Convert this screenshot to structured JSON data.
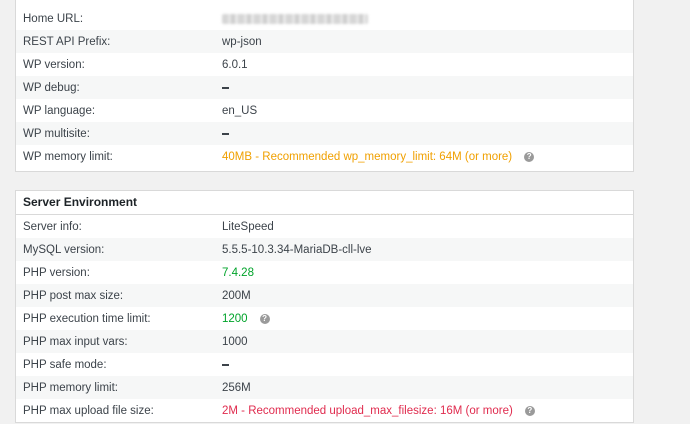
{
  "wordpress_environment": {
    "rows": [
      {
        "label": "Home URL:",
        "value": "",
        "type": "redacted"
      },
      {
        "label": "REST API Prefix:",
        "value": "wp-json",
        "type": "normal"
      },
      {
        "label": "WP version:",
        "value": "6.0.1",
        "type": "normal"
      },
      {
        "label": "WP debug:",
        "value": "",
        "type": "dash"
      },
      {
        "label": "WP language:",
        "value": "en_US",
        "type": "normal"
      },
      {
        "label": "WP multisite:",
        "value": "",
        "type": "dash"
      },
      {
        "label": "WP memory limit:",
        "value": "40MB - Recommended wp_memory_limit: 64M (or more)",
        "type": "warn",
        "help": true
      }
    ]
  },
  "server_environment": {
    "title": "Server Environment",
    "rows": [
      {
        "label": "Server info:",
        "value": "LiteSpeed",
        "type": "normal"
      },
      {
        "label": "MySQL version:",
        "value": "5.5.5-10.3.34-MariaDB-cll-lve",
        "type": "normal"
      },
      {
        "label": "PHP version:",
        "value": "7.4.28",
        "type": "ok"
      },
      {
        "label": "PHP post max size:",
        "value": "200M",
        "type": "normal"
      },
      {
        "label": "PHP execution time limit:",
        "value": "1200",
        "type": "ok",
        "help": true
      },
      {
        "label": "PHP max input vars:",
        "value": "1000",
        "type": "normal"
      },
      {
        "label": "PHP safe mode:",
        "value": "",
        "type": "dash"
      },
      {
        "label": "PHP memory limit:",
        "value": "256M",
        "type": "normal"
      },
      {
        "label": "PHP max upload file size:",
        "value": "2M - Recommended upload_max_filesize: 16M (or more)",
        "type": "err",
        "help": true
      }
    ]
  },
  "help_icon_glyph": "?",
  "colors": {
    "warning": "#f0a000",
    "success": "#00a32a",
    "error": "#e02b4e"
  }
}
